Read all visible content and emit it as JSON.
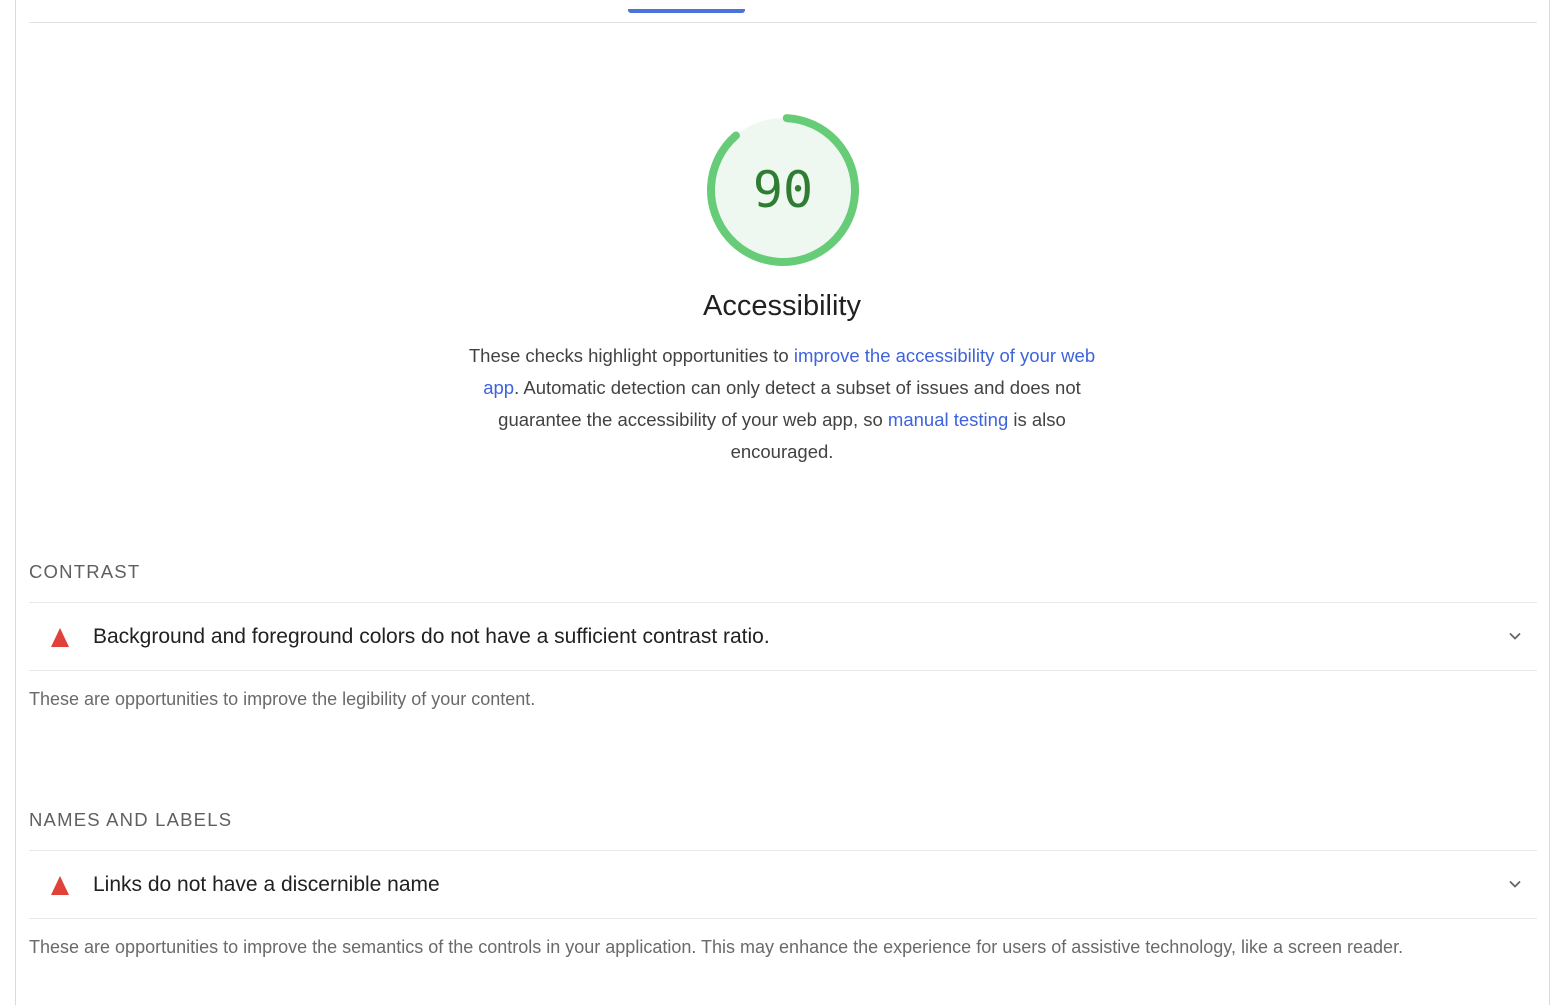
{
  "category": {
    "score": "90",
    "score_fraction": 0.9,
    "title": "Accessibility",
    "description": {
      "text_1": "These checks highlight opportunities to ",
      "link_1": "improve the accessibility of your web app",
      "text_2": ". Automatic detection can only detect a subset of issues and does not guarantee the accessibility of your web app, so ",
      "link_2": "manual testing",
      "text_3": " is also encouraged."
    },
    "colors": {
      "pass_stroke": "#66cc77",
      "pass_fill": "#eef8f0",
      "score_text": "#2e7d32",
      "link": "#3d63dd",
      "fail_icon": "#e0413a",
      "tab_accent": "#4a72d9"
    }
  },
  "groups": [
    {
      "heading": "CONTRAST",
      "audit": {
        "title": "Background and foreground colors do not have a sufficient contrast ratio.",
        "status_icon": "fail-triangle-icon",
        "expand_icon": "chevron-down-icon"
      },
      "description": "These are opportunities to improve the legibility of your content."
    },
    {
      "heading": "NAMES AND LABELS",
      "audit": {
        "title": "Links do not have a discernible name",
        "status_icon": "fail-triangle-icon",
        "expand_icon": "chevron-down-icon"
      },
      "description": "These are opportunities to improve the semantics of the controls in your application. This may enhance the experience for users of assistive technology, like a screen reader."
    }
  ]
}
